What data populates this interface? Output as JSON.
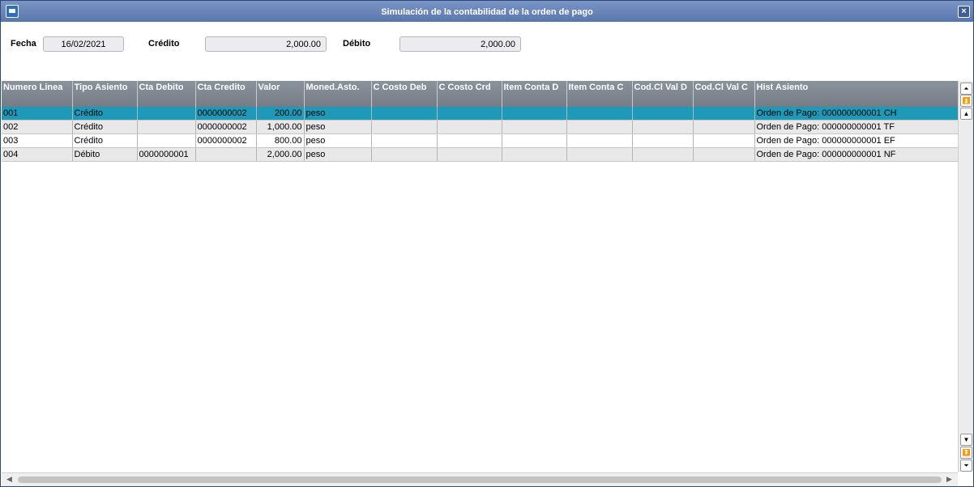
{
  "window": {
    "title": "Simulación de la contabilidad de la orden de pago"
  },
  "form": {
    "fecha_label": "Fecha",
    "fecha_value": "16/02/2021",
    "credito_label": "Crédito",
    "credito_value": "2,000.00",
    "debito_label": "Débito",
    "debito_value": "2,000.00"
  },
  "grid": {
    "columns": [
      "Numero Linea",
      "Tipo Asiento",
      "Cta Debito",
      "Cta Credito",
      "Valor",
      "Moned.Asto.",
      "C Costo Deb",
      "C Costo Crd",
      "Item Conta D",
      "Item Conta C",
      "Cod.Cl Val D",
      "Cod.Cl Val C",
      "Hist Asiento"
    ],
    "rows": [
      [
        "001",
        "Crédito",
        "",
        "0000000002",
        "200.00",
        "peso",
        "",
        "",
        "",
        "",
        "",
        "",
        "Orden de Pago: 000000000001 CH"
      ],
      [
        "002",
        "Crédito",
        "",
        "0000000002",
        "1,000.00",
        "peso",
        "",
        "",
        "",
        "",
        "",
        "",
        "Orden de Pago: 000000000001 TF"
      ],
      [
        "003",
        "Crédito",
        "",
        "0000000002",
        "800.00",
        "peso",
        "",
        "",
        "",
        "",
        "",
        "",
        "Orden de Pago: 000000000001 EF"
      ],
      [
        "004",
        "Débito",
        "0000000001",
        "",
        "2,000.00",
        "peso",
        "",
        "",
        "",
        "",
        "",
        "",
        "Orden de Pago: 000000000001 NF"
      ]
    ],
    "selected_row": 0
  },
  "icons": {
    "app": "window-icon",
    "close": "close-icon",
    "scroll_top": "double-chevron-up-icon",
    "scroll_pageup": "page-up-icon",
    "scroll_up": "arrow-up-icon",
    "scroll_down": "arrow-down-icon",
    "scroll_pagedown": "page-down-icon",
    "scroll_bottom": "double-chevron-down-icon"
  },
  "colors": {
    "titlebar": "#6682b8",
    "selected_row": "#1e9ab8",
    "header": "#7e8790"
  }
}
